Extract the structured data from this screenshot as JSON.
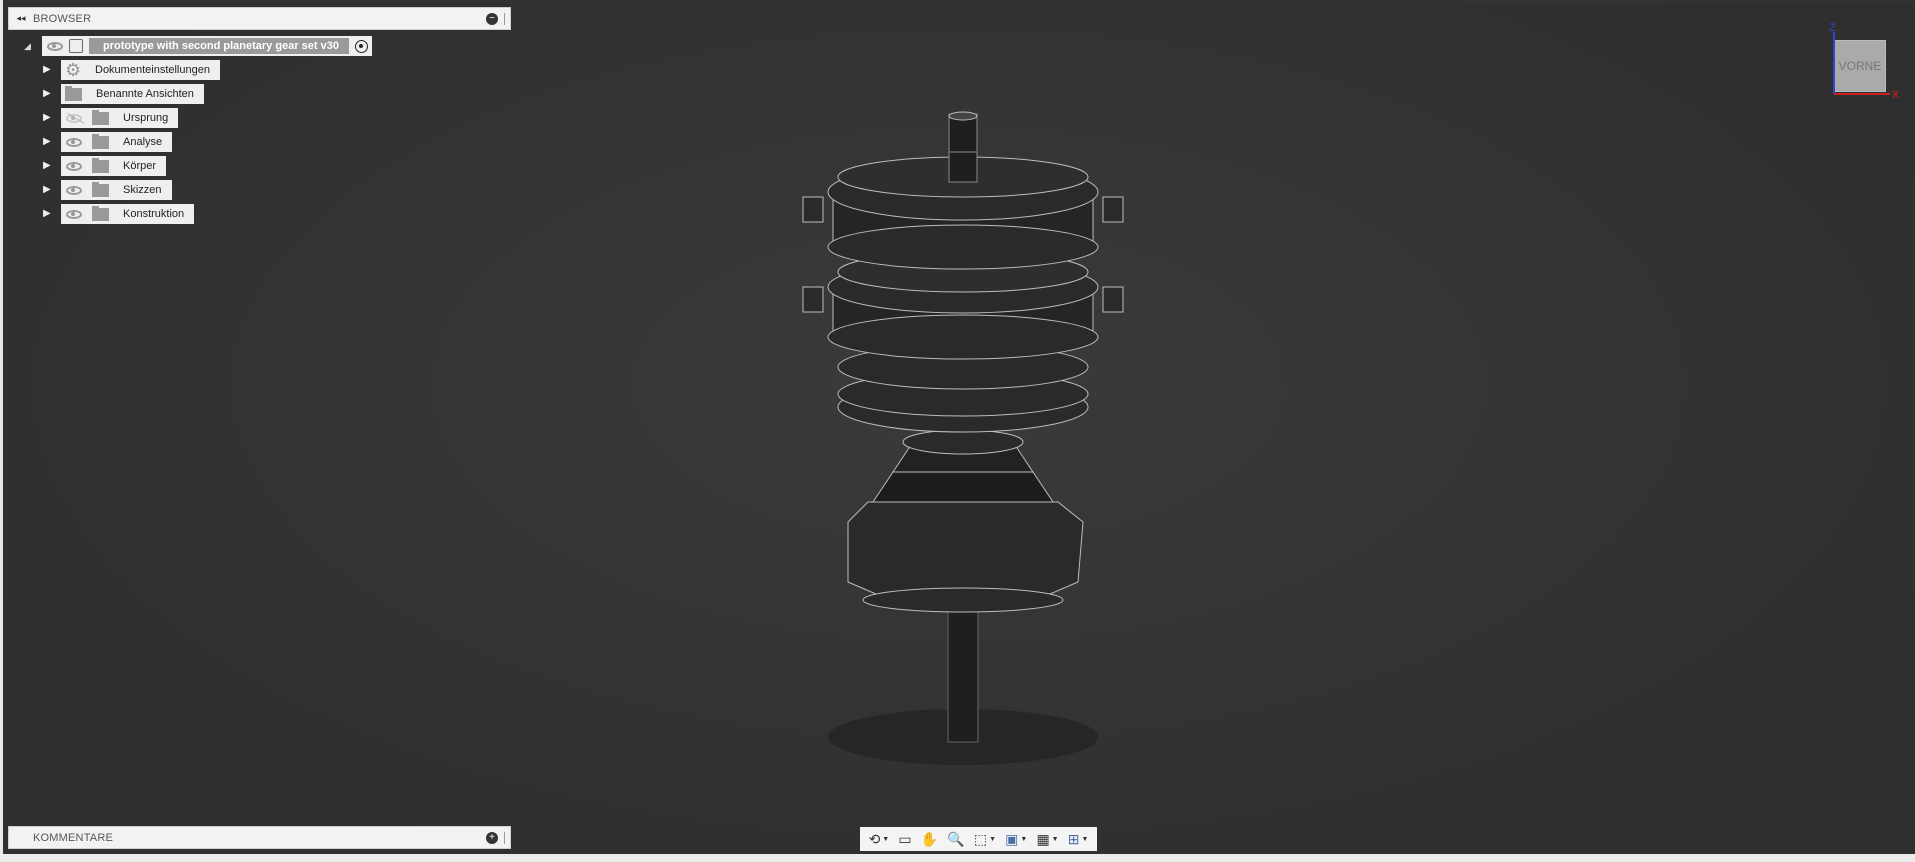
{
  "browser": {
    "title": "BROWSER",
    "root": "prototype with second planetary gear set v30",
    "items": [
      {
        "label": "Dokumenteinstellungen",
        "icon": "gear-icon",
        "eye": null
      },
      {
        "label": "Benannte Ansichten",
        "icon": "folder-icon",
        "eye": null
      },
      {
        "label": "Ursprung",
        "icon": "folder-icon",
        "eye": "hidden"
      },
      {
        "label": "Analyse",
        "icon": "folder-icon",
        "eye": "visible"
      },
      {
        "label": "Körper",
        "icon": "folder-icon",
        "eye": "visible"
      },
      {
        "label": "Skizzen",
        "icon": "folder-icon",
        "eye": "visible"
      },
      {
        "label": "Konstruktion",
        "icon": "folder-icon",
        "eye": "visible"
      }
    ]
  },
  "comments": {
    "title": "KOMMENTARE"
  },
  "viewcube": {
    "face": "VORNE",
    "axis_z": "Z",
    "axis_x": "X"
  },
  "toolbar": {
    "orbit": "⟲",
    "look": "▭",
    "pan": "✋",
    "zoom": "🔍",
    "fit": "⬚",
    "display": "▣",
    "grid": "▦",
    "viewports": "⊞"
  }
}
